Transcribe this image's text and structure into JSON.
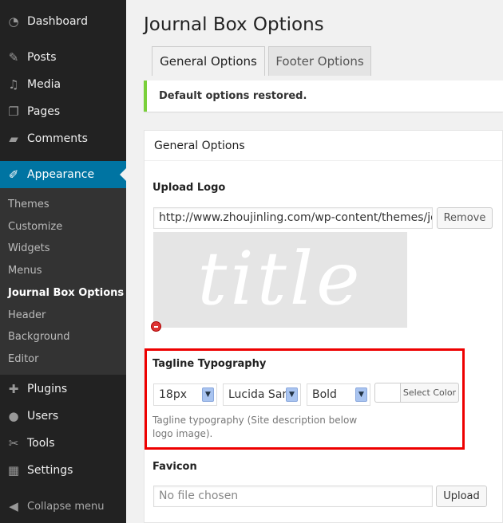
{
  "sidebar": {
    "items": [
      {
        "label": "Dashboard",
        "icon": "dashboard-icon",
        "glyph": "◔"
      },
      {
        "label": "Posts",
        "icon": "pin-icon",
        "glyph": "✎"
      },
      {
        "label": "Media",
        "icon": "media-icon",
        "glyph": "♫"
      },
      {
        "label": "Pages",
        "icon": "pages-icon",
        "glyph": "❐"
      },
      {
        "label": "Comments",
        "icon": "comment-icon",
        "glyph": "▰"
      },
      {
        "label": "Appearance",
        "icon": "paintbrush-icon",
        "glyph": "✐"
      },
      {
        "label": "Plugins",
        "icon": "plugin-icon",
        "glyph": "✚"
      },
      {
        "label": "Users",
        "icon": "user-icon",
        "glyph": "●"
      },
      {
        "label": "Tools",
        "icon": "wrench-icon",
        "glyph": "✂"
      },
      {
        "label": "Settings",
        "icon": "settings-icon",
        "glyph": "▦"
      }
    ],
    "submenu": [
      "Themes",
      "Customize",
      "Widgets",
      "Menus",
      "Journal Box Options",
      "Header",
      "Background",
      "Editor"
    ],
    "collapse": "Collapse menu"
  },
  "page": {
    "title": "Journal Box Options",
    "tabs": [
      "General Options",
      "Footer Options"
    ],
    "notice": "Default options restored."
  },
  "panel": {
    "title": "General Options",
    "upload_logo": {
      "label": "Upload Logo",
      "value": "http://www.zhoujinling.com/wp-content/themes/journal-box",
      "remove": "Remove",
      "preview_text": "title"
    },
    "tagline": {
      "label": "Tagline Typography",
      "size": "18px",
      "font": "Lucida Sans",
      "weight": "Bold",
      "color_button": "Select Color",
      "description": "Tagline typography (Site description below logo image)."
    },
    "favicon": {
      "label": "Favicon",
      "placeholder": "No file chosen",
      "upload": "Upload"
    }
  },
  "colors": {
    "sidebar": "#222222",
    "active": "#0074a2",
    "notice_border": "#7ad03a",
    "highlight_box": "#ee0000"
  }
}
